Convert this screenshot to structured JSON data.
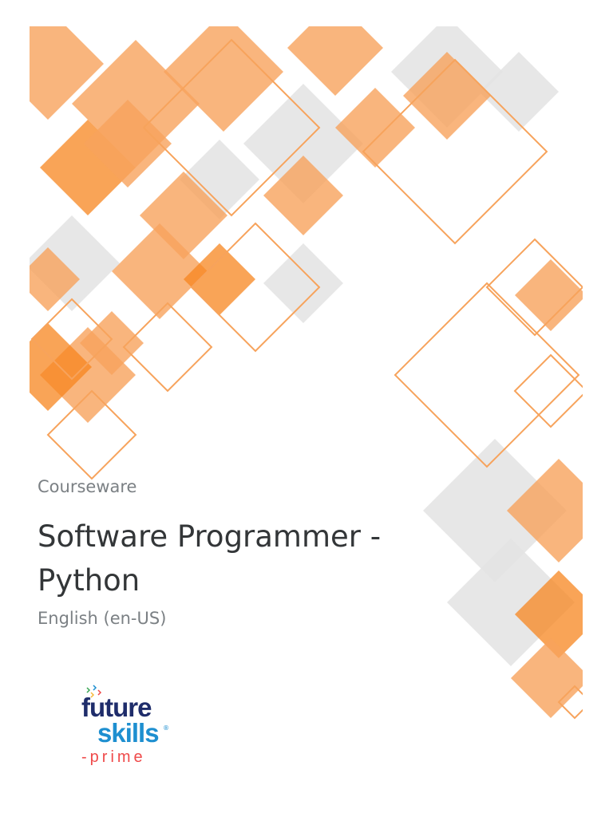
{
  "cover": {
    "kicker": "Courseware",
    "title": "Software Programmer - Python",
    "language": "English (en-US)"
  },
  "logo": {
    "line1": "future",
    "line2": "skills",
    "line3": "-prime",
    "registered": "®"
  },
  "colors": {
    "orange": "#f7a35c",
    "orange_dark": "#f7861f",
    "gray": "#e3e3e3",
    "text": "#333638",
    "muted": "#7b8084"
  }
}
